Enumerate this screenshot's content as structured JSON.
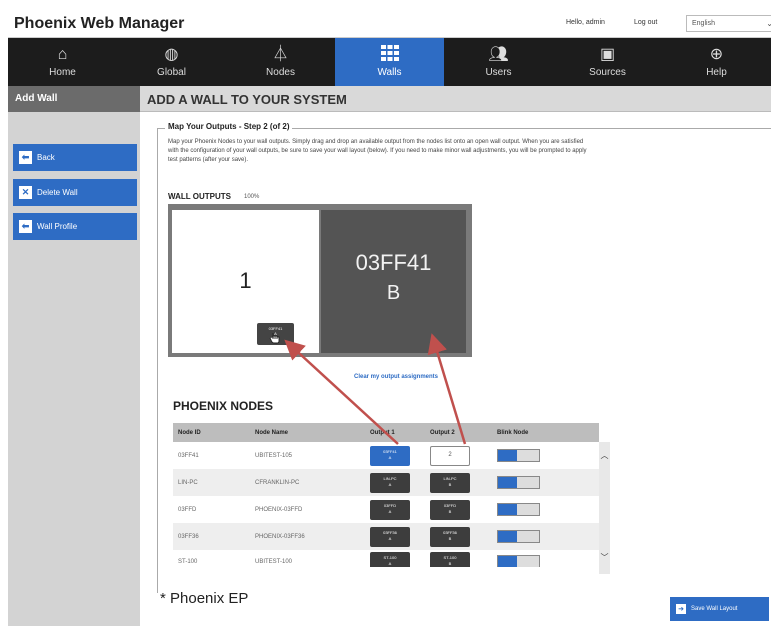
{
  "header": {
    "title": "Phoenix Web Manager",
    "greeting": "Hello, admin",
    "logout": "Log out",
    "language": "English"
  },
  "nav": {
    "items": [
      {
        "label": "Home",
        "icon": "home-icon"
      },
      {
        "label": "Global",
        "icon": "globe-icon"
      },
      {
        "label": "Nodes",
        "icon": "nodes-icon"
      },
      {
        "label": "Walls",
        "icon": "grid-icon",
        "active": true
      },
      {
        "label": "Users",
        "icon": "users-icon"
      },
      {
        "label": "Sources",
        "icon": "source-icon"
      },
      {
        "label": "Help",
        "icon": "help-icon"
      }
    ]
  },
  "sidebar": {
    "header": "Add Wall",
    "buttons": [
      {
        "label": "Back",
        "icon": "back-arrow-icon"
      },
      {
        "label": "Delete Wall",
        "icon": "delete-icon"
      },
      {
        "label": "Wall Profile",
        "icon": "back-arrow-icon"
      }
    ]
  },
  "main": {
    "title": "ADD A WALL TO YOUR SYSTEM",
    "step_title": "Map Your Outputs - Step 2 (of 2)",
    "description": "Map your Phoenix Nodes to your wall outputs. Simply drag and drop an available output from the nodes list onto an open wall output. When you are satisfied with the configuration of your wall outputs, be sure to save your wall layout (below). If you need to make minor wall adjustments, you will be prompted to apply test patterns (after your save).",
    "wall_outputs_label": "WALL OUTPUTS",
    "wall_outputs_zoom": "100%",
    "output1_number": "1",
    "drag_chip_line1": "03FF41",
    "drag_chip_line2": "A",
    "output2_id": "03FF41",
    "output2_port": "B",
    "clear_link": "Clear my output assignments",
    "nodes_title": "PHOENIX NODES",
    "table_headers": [
      "Node ID",
      "Node Name",
      "Output 1",
      "Output 2",
      "Blink Node"
    ],
    "rows": [
      {
        "id": "03FF41",
        "name": "UBITEST-105",
        "o1_line1": "03FF41",
        "o1_line2": "A",
        "o2_text": "2"
      },
      {
        "id": "LIN-PC",
        "name": "CFRANKLIN-PC",
        "o1_line1": "LIN-PC",
        "o1_line2": "A",
        "o2_line1": "LIN-PC",
        "o2_line2": "B"
      },
      {
        "id": "03FFD",
        "name": "PHOENIX-03FFD",
        "o1_line1": "03FFD",
        "o1_line2": "A",
        "o2_line1": "03FFD",
        "o2_line2": "B"
      },
      {
        "id": "03FF36",
        "name": "PHOENIX-03FF36",
        "o1_line1": "03FF36",
        "o1_line2": "A",
        "o2_line1": "03FF36",
        "o2_line2": "B"
      },
      {
        "id": "ST-100",
        "name": "UBITEST-100",
        "o1_line1": "ST-100",
        "o1_line2": "A",
        "o2_line1": "ST-100",
        "o2_line2": "B"
      }
    ],
    "footnote": "* Phoenix EP",
    "save_label": "Save Wall Layout"
  },
  "colors": {
    "accent": "#2e6cc4",
    "nav_bg": "#1c1c1c",
    "sidebar_bg": "#d3d3d3",
    "arrow": "#c0504d"
  }
}
